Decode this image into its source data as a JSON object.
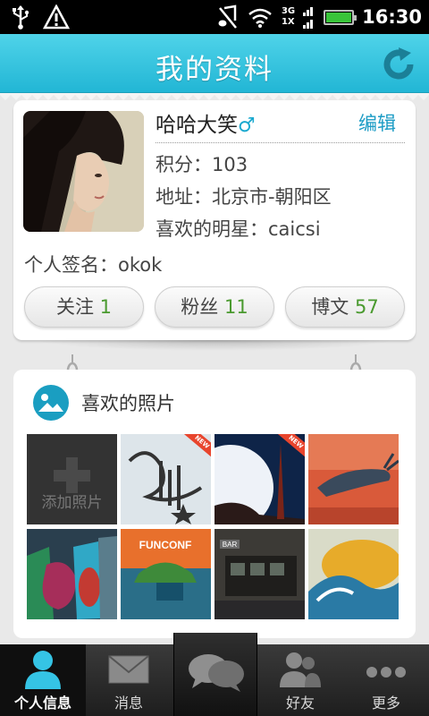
{
  "status_bar": {
    "time": "16:30",
    "network_top": "3G",
    "network_bottom": "1X",
    "battery_level": 1.0,
    "icons": [
      "usb-icon",
      "warning-icon",
      "mute-icon",
      "wifi-icon",
      "signal-icon",
      "battery-icon"
    ]
  },
  "header": {
    "title": "我的资料",
    "refresh_icon": "refresh-icon"
  },
  "profile": {
    "name": "哈哈大笑",
    "gender_symbol": "♂",
    "edit_label": "编辑",
    "points": "积分：103",
    "address": "地址：北京市-朝阳区",
    "favorite_star": "喜欢的明星：caicsi",
    "signature": "个人签名：okok",
    "stats": [
      {
        "label": "关注",
        "value": "1"
      },
      {
        "label": "粉丝",
        "value": "11"
      },
      {
        "label": "博文",
        "value": "57"
      }
    ]
  },
  "photos": {
    "title": "喜欢的照片",
    "add_label": "添加照片",
    "new_badge": "NEW",
    "tile_texts": {
      "funconf": "FUNCONF",
      "bar": "BAR"
    }
  },
  "tabs": [
    {
      "label": "个人信息",
      "icon": "person-icon",
      "active": true
    },
    {
      "label": "消息",
      "icon": "envelope-icon",
      "active": false
    },
    {
      "label": "",
      "icon": "chat-bubbles-icon",
      "active": false
    },
    {
      "label": "好友",
      "icon": "friends-icon",
      "active": false
    },
    {
      "label": "更多",
      "icon": "more-dots-icon",
      "active": false
    }
  ],
  "colors": {
    "accent": "#22b6d5",
    "stat_number": "#4a9a2f",
    "edit_link": "#1c9cc5"
  }
}
